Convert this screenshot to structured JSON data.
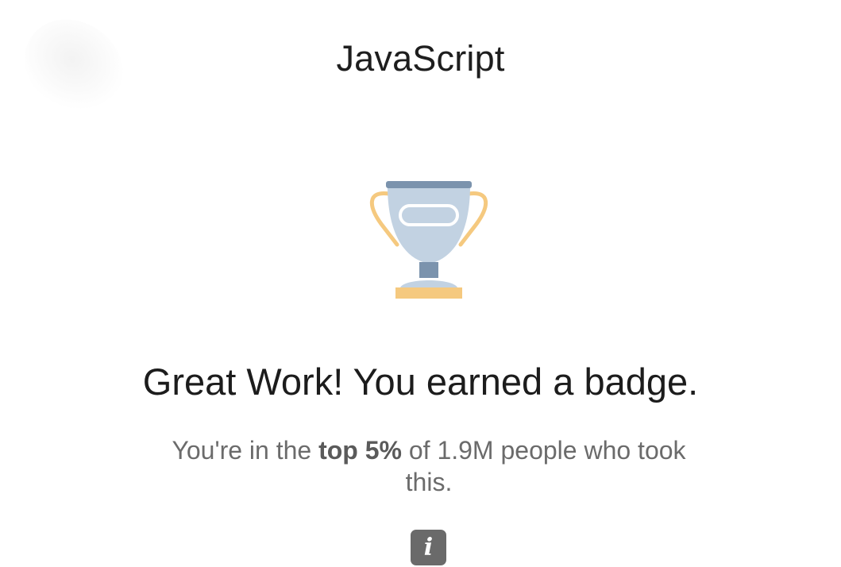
{
  "header": {
    "title": "JavaScript",
    "back_icon": "back-arrow-icon"
  },
  "badge": {
    "icon": "trophy-icon",
    "colors": {
      "cup": "#c2d2e2",
      "rim": "#7b93ad",
      "handles": "#f5c97f",
      "base": "#f5c97f",
      "stem": "#7b93ad"
    }
  },
  "result": {
    "headline": "Great Work! You earned a badge.",
    "stat_prefix": "You're in the ",
    "stat_highlight": "top 5%",
    "stat_suffix": " of 1.9M people who took this."
  },
  "info": {
    "icon": "info-icon",
    "glyph": "i"
  }
}
